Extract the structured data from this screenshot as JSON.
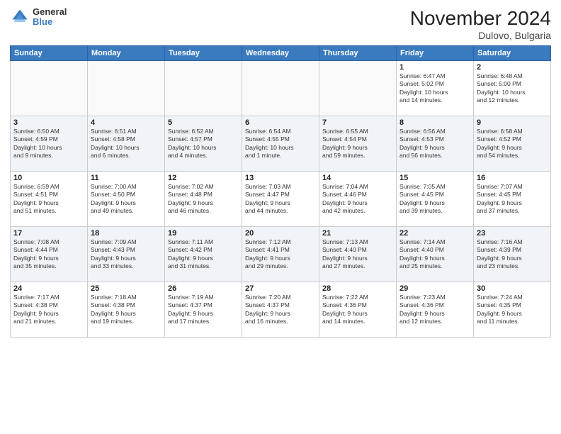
{
  "logo": {
    "general": "General",
    "blue": "Blue"
  },
  "title": "November 2024",
  "location": "Dulovo, Bulgaria",
  "days_of_week": [
    "Sunday",
    "Monday",
    "Tuesday",
    "Wednesday",
    "Thursday",
    "Friday",
    "Saturday"
  ],
  "weeks": [
    [
      {
        "day": "",
        "info": ""
      },
      {
        "day": "",
        "info": ""
      },
      {
        "day": "",
        "info": ""
      },
      {
        "day": "",
        "info": ""
      },
      {
        "day": "",
        "info": ""
      },
      {
        "day": "1",
        "info": "Sunrise: 6:47 AM\nSunset: 5:02 PM\nDaylight: 10 hours\nand 14 minutes."
      },
      {
        "day": "2",
        "info": "Sunrise: 6:48 AM\nSunset: 5:00 PM\nDaylight: 10 hours\nand 12 minutes."
      }
    ],
    [
      {
        "day": "3",
        "info": "Sunrise: 6:50 AM\nSunset: 4:59 PM\nDaylight: 10 hours\nand 9 minutes."
      },
      {
        "day": "4",
        "info": "Sunrise: 6:51 AM\nSunset: 4:58 PM\nDaylight: 10 hours\nand 6 minutes."
      },
      {
        "day": "5",
        "info": "Sunrise: 6:52 AM\nSunset: 4:57 PM\nDaylight: 10 hours\nand 4 minutes."
      },
      {
        "day": "6",
        "info": "Sunrise: 6:54 AM\nSunset: 4:55 PM\nDaylight: 10 hours\nand 1 minute."
      },
      {
        "day": "7",
        "info": "Sunrise: 6:55 AM\nSunset: 4:54 PM\nDaylight: 9 hours\nand 59 minutes."
      },
      {
        "day": "8",
        "info": "Sunrise: 6:56 AM\nSunset: 4:53 PM\nDaylight: 9 hours\nand 56 minutes."
      },
      {
        "day": "9",
        "info": "Sunrise: 6:58 AM\nSunset: 4:52 PM\nDaylight: 9 hours\nand 54 minutes."
      }
    ],
    [
      {
        "day": "10",
        "info": "Sunrise: 6:59 AM\nSunset: 4:51 PM\nDaylight: 9 hours\nand 51 minutes."
      },
      {
        "day": "11",
        "info": "Sunrise: 7:00 AM\nSunset: 4:50 PM\nDaylight: 9 hours\nand 49 minutes."
      },
      {
        "day": "12",
        "info": "Sunrise: 7:02 AM\nSunset: 4:48 PM\nDaylight: 9 hours\nand 46 minutes."
      },
      {
        "day": "13",
        "info": "Sunrise: 7:03 AM\nSunset: 4:47 PM\nDaylight: 9 hours\nand 44 minutes."
      },
      {
        "day": "14",
        "info": "Sunrise: 7:04 AM\nSunset: 4:46 PM\nDaylight: 9 hours\nand 42 minutes."
      },
      {
        "day": "15",
        "info": "Sunrise: 7:05 AM\nSunset: 4:45 PM\nDaylight: 9 hours\nand 39 minutes."
      },
      {
        "day": "16",
        "info": "Sunrise: 7:07 AM\nSunset: 4:45 PM\nDaylight: 9 hours\nand 37 minutes."
      }
    ],
    [
      {
        "day": "17",
        "info": "Sunrise: 7:08 AM\nSunset: 4:44 PM\nDaylight: 9 hours\nand 35 minutes."
      },
      {
        "day": "18",
        "info": "Sunrise: 7:09 AM\nSunset: 4:43 PM\nDaylight: 9 hours\nand 33 minutes."
      },
      {
        "day": "19",
        "info": "Sunrise: 7:11 AM\nSunset: 4:42 PM\nDaylight: 9 hours\nand 31 minutes."
      },
      {
        "day": "20",
        "info": "Sunrise: 7:12 AM\nSunset: 4:41 PM\nDaylight: 9 hours\nand 29 minutes."
      },
      {
        "day": "21",
        "info": "Sunrise: 7:13 AM\nSunset: 4:40 PM\nDaylight: 9 hours\nand 27 minutes."
      },
      {
        "day": "22",
        "info": "Sunrise: 7:14 AM\nSunset: 4:40 PM\nDaylight: 9 hours\nand 25 minutes."
      },
      {
        "day": "23",
        "info": "Sunrise: 7:16 AM\nSunset: 4:39 PM\nDaylight: 9 hours\nand 23 minutes."
      }
    ],
    [
      {
        "day": "24",
        "info": "Sunrise: 7:17 AM\nSunset: 4:38 PM\nDaylight: 9 hours\nand 21 minutes."
      },
      {
        "day": "25",
        "info": "Sunrise: 7:18 AM\nSunset: 4:38 PM\nDaylight: 9 hours\nand 19 minutes."
      },
      {
        "day": "26",
        "info": "Sunrise: 7:19 AM\nSunset: 4:37 PM\nDaylight: 9 hours\nand 17 minutes."
      },
      {
        "day": "27",
        "info": "Sunrise: 7:20 AM\nSunset: 4:37 PM\nDaylight: 9 hours\nand 16 minutes."
      },
      {
        "day": "28",
        "info": "Sunrise: 7:22 AM\nSunset: 4:36 PM\nDaylight: 9 hours\nand 14 minutes."
      },
      {
        "day": "29",
        "info": "Sunrise: 7:23 AM\nSunset: 4:36 PM\nDaylight: 9 hours\nand 12 minutes."
      },
      {
        "day": "30",
        "info": "Sunrise: 7:24 AM\nSunset: 4:35 PM\nDaylight: 9 hours\nand 11 minutes."
      }
    ]
  ]
}
